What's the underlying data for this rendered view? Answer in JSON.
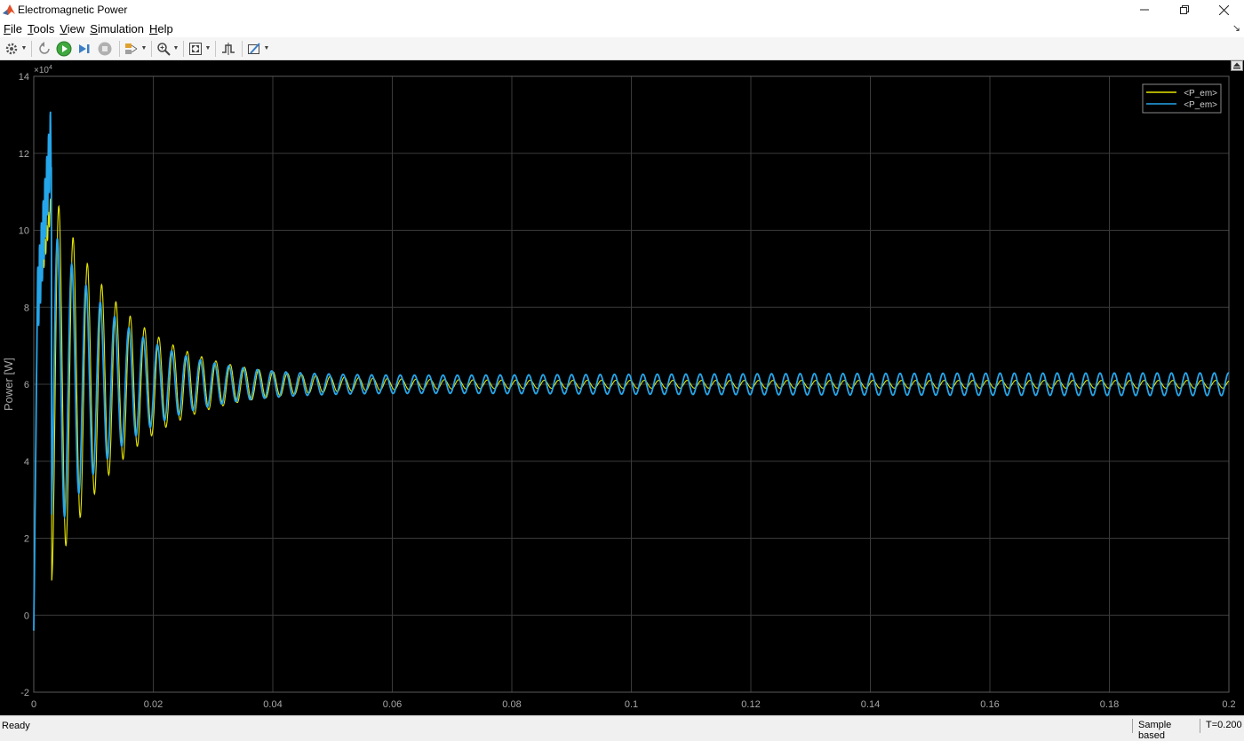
{
  "window": {
    "title": "Electromagnetic Power",
    "controls": [
      "minimize-icon",
      "restore-icon",
      "close-icon"
    ]
  },
  "menu": {
    "items": [
      {
        "label": "File",
        "accel": "F"
      },
      {
        "label": "Tools",
        "accel": "T"
      },
      {
        "label": "View",
        "accel": "V"
      },
      {
        "label": "Simulation",
        "accel": "S"
      },
      {
        "label": "Help",
        "accel": "H"
      }
    ]
  },
  "toolbar": {
    "icons": [
      "settings-icon",
      "step-back-icon",
      "run-icon",
      "step-forward-icon",
      "stop-icon",
      "highlight-icon",
      "zoom-in-icon",
      "fit-to-view-icon",
      "triggers-icon",
      "measurements-icon"
    ]
  },
  "colors": {
    "series1": "#e6e600",
    "series2": "#26a6ea",
    "background": "#000000",
    "grid": "#3a3a3a",
    "axis_text": "#a8a8a8"
  },
  "chart_data": {
    "type": "line",
    "ylabel": "Power [W]",
    "xlabel": "",
    "exponent_label": "×10",
    "exponent_power": "4",
    "xlim": [
      0,
      0.2
    ],
    "ylim": [
      -2,
      14
    ],
    "x_ticks": [
      "0",
      "0.02",
      "0.04",
      "0.06",
      "0.08",
      "0.1",
      "0.12",
      "0.14",
      "0.16",
      "0.18",
      "0.2"
    ],
    "y_ticks": [
      "-2",
      "0",
      "2",
      "4",
      "6",
      "8",
      "10",
      "12",
      "14"
    ],
    "grid": true,
    "legend_position": "top-right",
    "series": [
      {
        "name": "<P_em>",
        "color": "#e6e600",
        "model": {
          "mean": 6.0,
          "initial_amplitude": 5.0,
          "decay_tau": 0.012,
          "oscillation_period": 0.00239,
          "steady_amplitude": 0.1,
          "peak": 10.8,
          "trough": 1.6
        }
      },
      {
        "name": "<P_em>",
        "color": "#26a6ea",
        "model": {
          "mean": 6.0,
          "initial_amplitude": 4.1,
          "decay_tau": 0.012,
          "oscillation_period": 0.00239,
          "steady_amplitude": 0.3,
          "peak": 12.6,
          "trough": -0.4
        }
      }
    ]
  },
  "status": {
    "text": "Ready",
    "mode": "Sample based",
    "time": "T=0.200"
  }
}
